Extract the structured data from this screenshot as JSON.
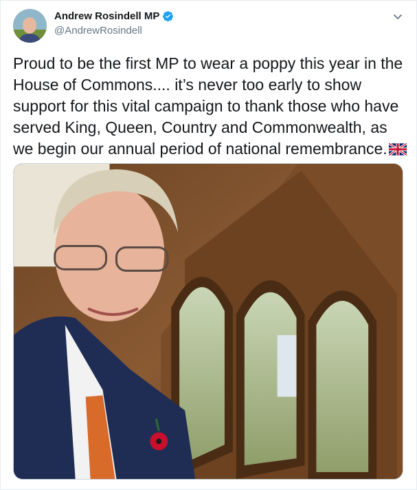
{
  "author": {
    "display_name": "Andrew Rosindell MP",
    "handle": "@AndrewRosindell",
    "verified": true
  },
  "tweet": {
    "text": "Proud to be the first MP to wear a poppy this year in the House of Commons.... it’s never too early to show support for this vital campaign to thank those who have served King, Queen, Country and Commonwealth, as we begin our annual period of national remembrance."
  },
  "icons": {
    "verified": "verified-badge-icon",
    "more": "chevron-down-icon",
    "emoji": "uk-flag-icon"
  },
  "colors": {
    "verified_blue": "#1da1f2",
    "text": "#14171a",
    "secondary": "#657786"
  }
}
